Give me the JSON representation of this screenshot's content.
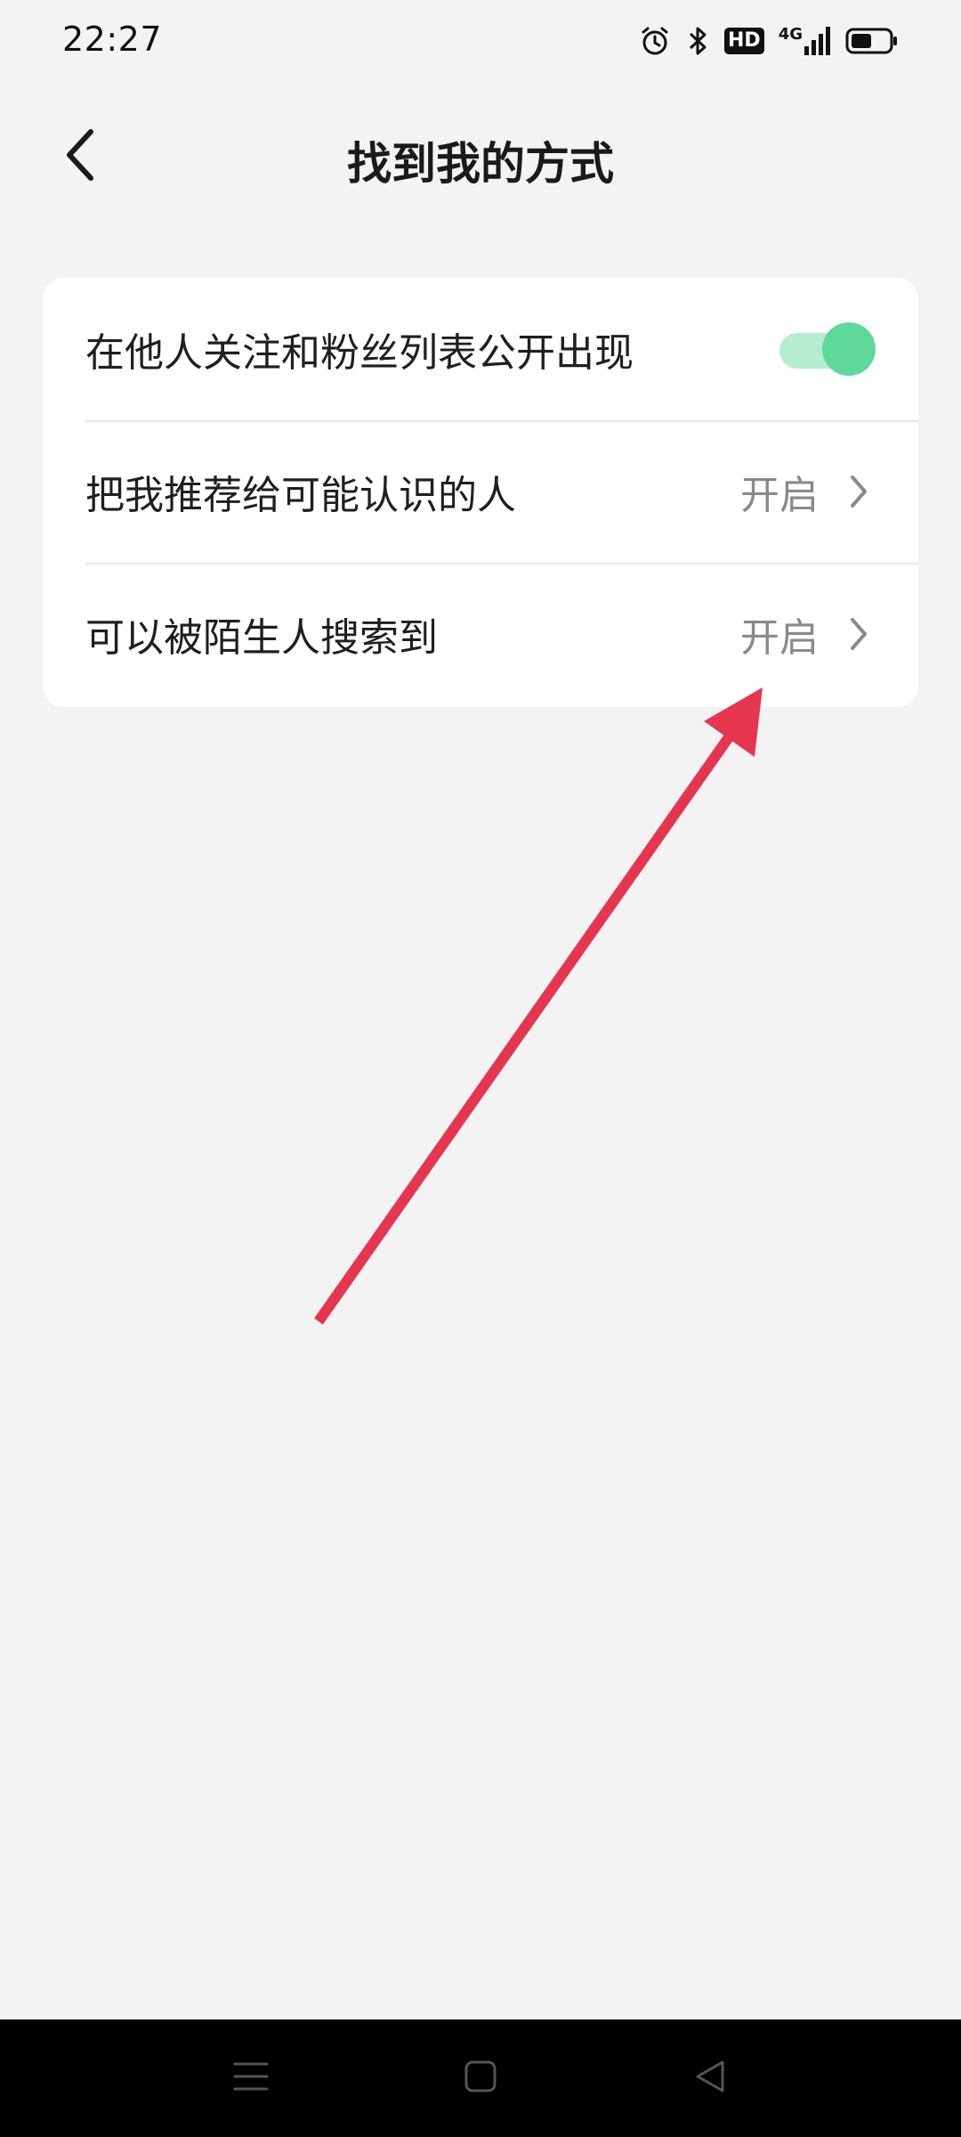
{
  "status_bar": {
    "time": "22:27",
    "icons": [
      "alarm-icon",
      "bluetooth-icon",
      "hd-icon",
      "signal-4g-icon",
      "battery-icon"
    ],
    "hd_label": "HD",
    "network_label": "4G"
  },
  "header": {
    "title": "找到我的方式",
    "back_icon": "chevron-left-icon"
  },
  "settings": {
    "items": [
      {
        "label": "在他人关注和粉丝列表公开出现",
        "control": "toggle",
        "enabled": true
      },
      {
        "label": "把我推荐给可能认识的人",
        "value": "开启",
        "control": "chevron"
      },
      {
        "label": "可以被陌生人搜索到",
        "value": "开启",
        "control": "chevron"
      }
    ]
  },
  "colors": {
    "background": "#f3f3f3",
    "card": "#ffffff",
    "toggle_track": "#b6ecd2",
    "toggle_knob": "#5fd99b",
    "annotation_arrow": "#e6364f",
    "nav_bar": "#000000"
  },
  "nav_bar": {
    "icons": [
      "menu-icon",
      "home-icon",
      "back-triangle-icon"
    ]
  }
}
